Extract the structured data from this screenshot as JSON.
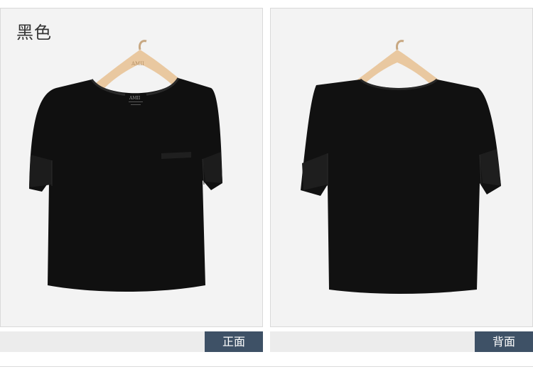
{
  "color_title": "黑色",
  "front": {
    "label": "正面",
    "hanger_text": "AMII",
    "tag_brand": "AMII"
  },
  "back": {
    "label": "背面"
  },
  "colors": {
    "garment": "#101010",
    "hanger": "#e9c8a0",
    "label_tab": "#3e5166",
    "panel_bg": "#f3f3f3"
  }
}
